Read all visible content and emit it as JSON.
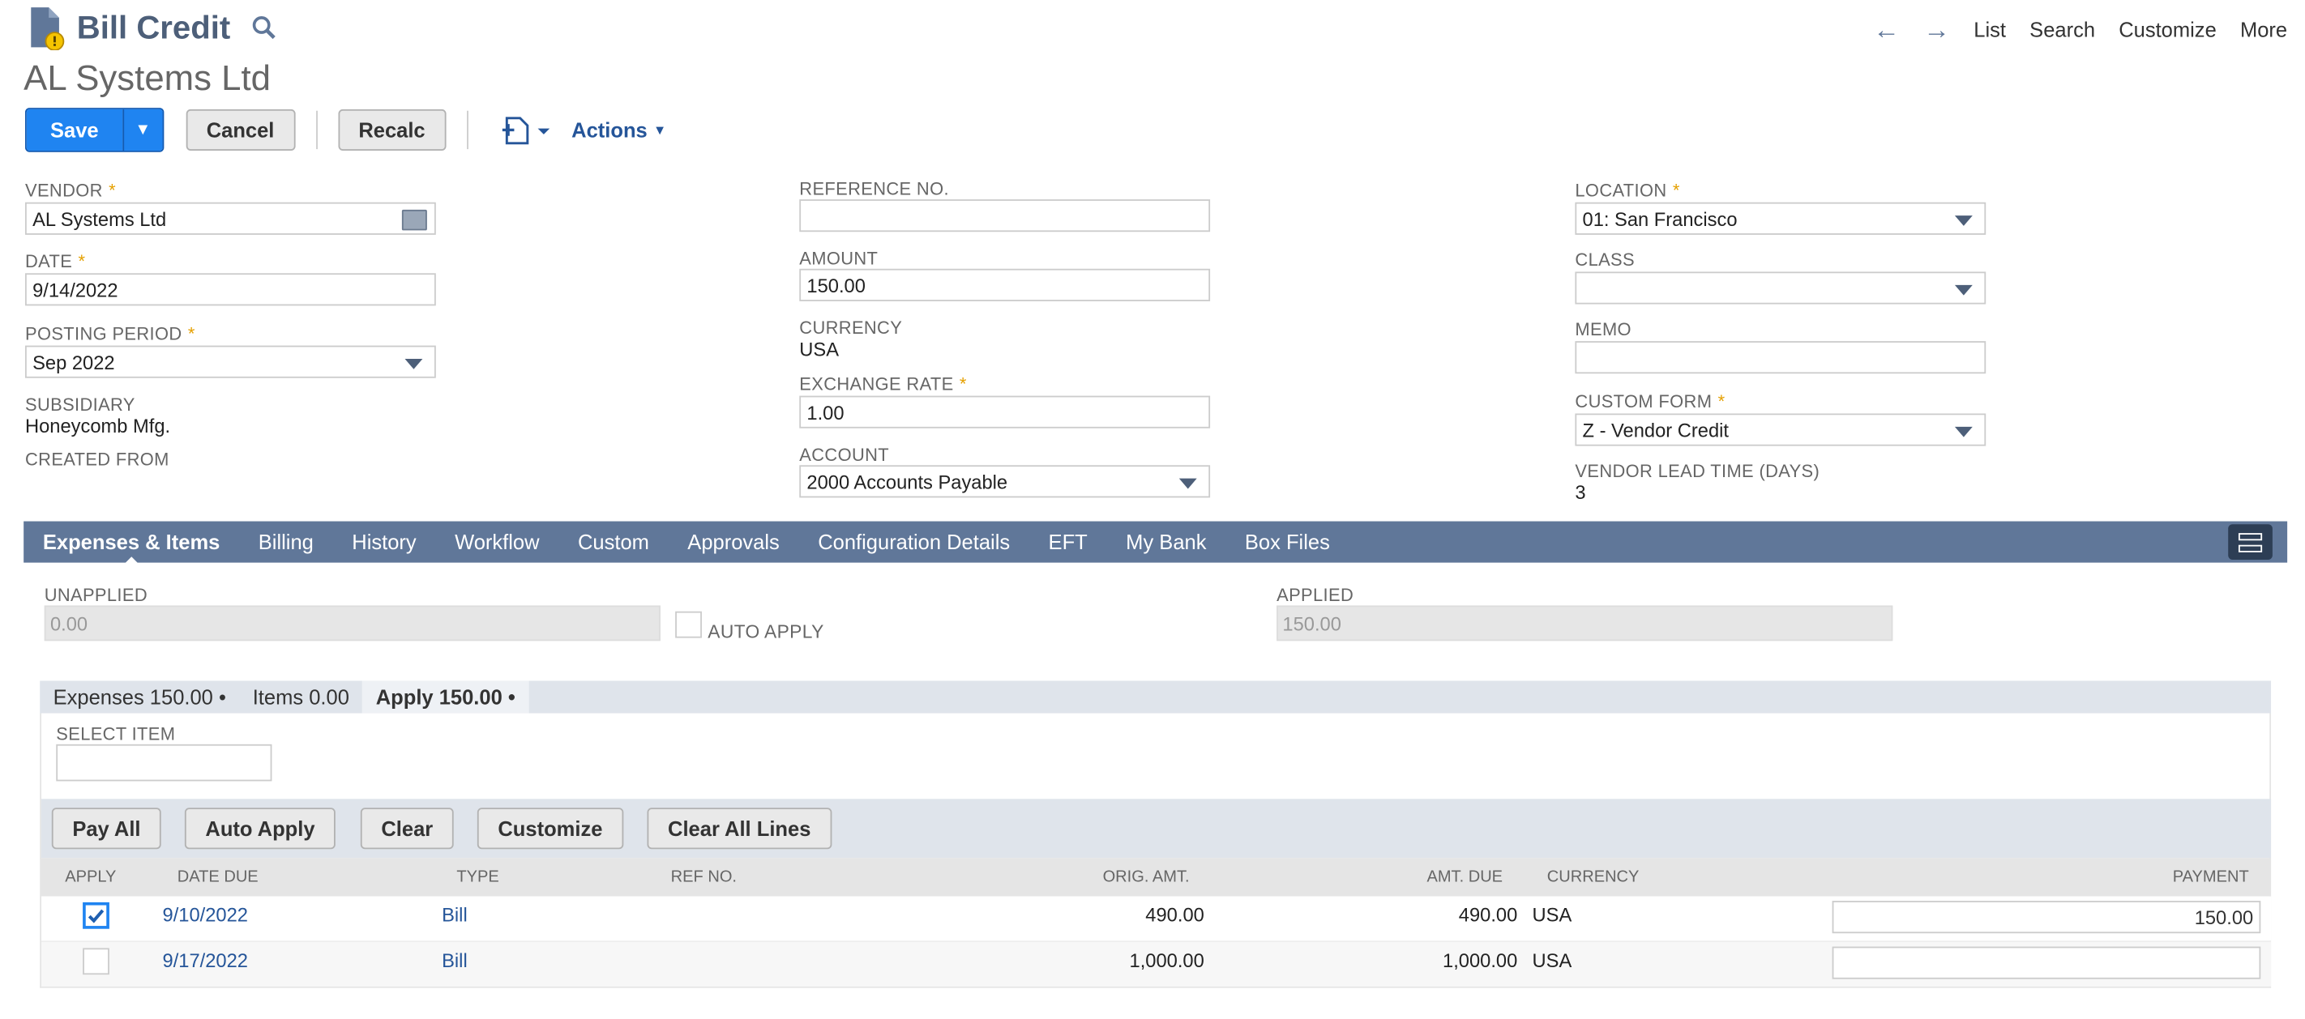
{
  "app": {
    "record_type": "Bill Credit",
    "record_name": "AL Systems Ltd"
  },
  "nav": {
    "list": "List",
    "search": "Search",
    "customize": "Customize",
    "more": "More"
  },
  "buttons": {
    "save": "Save",
    "cancel": "Cancel",
    "recalc": "Recalc",
    "actions": "Actions"
  },
  "fields": {
    "vendor_label": "VENDOR",
    "vendor": "AL Systems Ltd",
    "date_label": "DATE",
    "date": "9/14/2022",
    "posting_period_label": "POSTING PERIOD",
    "posting_period": "Sep 2022",
    "subsidiary_label": "SUBSIDIARY",
    "subsidiary": "Honeycomb Mfg.",
    "created_from_label": "CREATED FROM",
    "reference_no_label": "REFERENCE NO.",
    "reference_no": "",
    "amount_label": "AMOUNT",
    "amount": "150.00",
    "currency_label": "CURRENCY",
    "currency": "USA",
    "exchange_rate_label": "EXCHANGE RATE",
    "exchange_rate": "1.00",
    "account_label": "ACCOUNT",
    "account": "2000 Accounts Payable",
    "location_label": "LOCATION",
    "location": "01: San Francisco",
    "class_label": "CLASS",
    "class": "",
    "memo_label": "MEMO",
    "memo": "",
    "custom_form_label": "CUSTOM FORM",
    "custom_form": "Z - Vendor Credit",
    "vendor_lead_time_label": "VENDOR LEAD TIME (DAYS)",
    "vendor_lead_time": "3",
    "required_mark": "*"
  },
  "tabs": [
    "Expenses & Items",
    "Billing",
    "History",
    "Workflow",
    "Custom",
    "Approvals",
    "Configuration Details",
    "EFT",
    "My Bank",
    "Box Files"
  ],
  "apply_section": {
    "unapplied_label": "UNAPPLIED",
    "unapplied": "0.00",
    "auto_apply_label": "AUTO APPLY",
    "applied_label": "APPLIED",
    "applied": "150.00"
  },
  "subtabs": [
    "Expenses 150.00 •",
    "Items 0.00",
    "Apply 150.00 •"
  ],
  "select_item_label": "SELECT ITEM",
  "sublist_buttons": [
    "Pay All",
    "Auto Apply",
    "Clear",
    "Customize",
    "Clear All Lines"
  ],
  "columns": [
    "APPLY",
    "DATE DUE",
    "TYPE",
    "REF NO.",
    "ORIG. AMT.",
    "AMT. DUE",
    "CURRENCY",
    "PAYMENT"
  ],
  "rows": [
    {
      "apply": true,
      "date_due": "9/10/2022",
      "type": "Bill",
      "ref_no": "",
      "orig_amt": "490.00",
      "amt_due": "490.00",
      "currency": "USA",
      "payment": "150.00"
    },
    {
      "apply": false,
      "date_due": "9/17/2022",
      "type": "Bill",
      "ref_no": "",
      "orig_amt": "1,000.00",
      "amt_due": "1,000.00",
      "currency": "USA",
      "payment": ""
    }
  ],
  "colors": {
    "tab_bar": "#607799",
    "save_blue": "#1f84f1",
    "link": "#255599",
    "required": "#e5a000"
  }
}
